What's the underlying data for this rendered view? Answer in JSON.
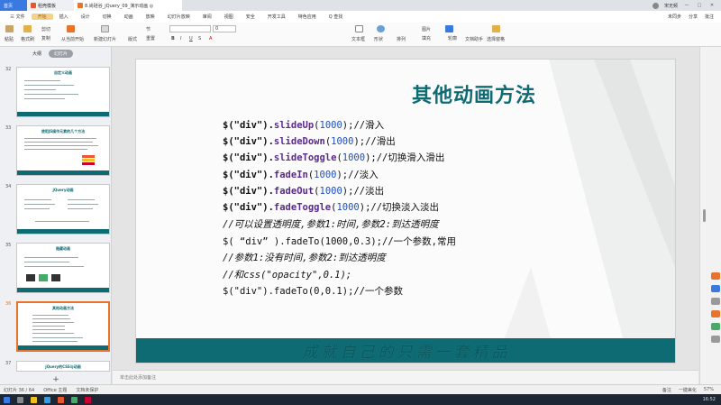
{
  "window": {
    "tabs": [
      {
        "label": "首页"
      },
      {
        "label": "稻壳模板"
      },
      {
        "label": "8.尚硅谷_jQuery_09_演示动画 ◎"
      }
    ],
    "user": "宋无频"
  },
  "menubar": {
    "items": [
      "三 文件",
      "开始",
      "插入",
      "设计",
      "切换",
      "动画",
      "放映",
      "幻灯片放映",
      "审阅",
      "视图",
      "安全",
      "开发工具",
      "特色应用",
      "Q 查找"
    ],
    "active_index": 1,
    "right": [
      "未同步",
      "分享",
      "批注"
    ]
  },
  "ribbon": {
    "paste": "粘贴",
    "format_painter": "格式刷",
    "cut": "剪切",
    "copy": "复制",
    "from_current": "从当前开始",
    "new_slide": "新建幻灯片",
    "layout": "版式",
    "section": "节",
    "reset": "重置",
    "font_size": "0",
    "textbox": "文本框",
    "shape": "形状",
    "arrange": "排列",
    "outline": "轮廓",
    "picture": "图片",
    "fill": "填充",
    "text_effects": "文档助手",
    "select_pane": "选择窗格"
  },
  "leftpanel": {
    "tabs": [
      "大纲",
      "幻灯片"
    ],
    "slides": [
      {
        "num": "32",
        "title": "自定义动画"
      },
      {
        "num": "33",
        "title": "使用JS操作元素的几个方法"
      },
      {
        "num": "34",
        "title": "jQuery动画"
      },
      {
        "num": "35",
        "title": "隐藏动画"
      },
      {
        "num": "36",
        "title": "其他动画方法"
      },
      {
        "num": "37",
        "title": "jQuery的CSS与动画"
      }
    ],
    "selected_index": 4,
    "add_label": "+"
  },
  "slide": {
    "title": "其他动画方法",
    "code_lines": [
      {
        "pre": "$(\"div\").",
        "fn": "slideUp",
        "open": "(",
        "num": "1000",
        "post": ");//滑入"
      },
      {
        "pre": "$(\"div\").",
        "fn": "slideDown",
        "open": "(",
        "num": "1000",
        "post": ");//滑出"
      },
      {
        "pre": "$(\"div\").",
        "fn": "slideToggle",
        "open": "(",
        "num": "1000",
        "post": ");//切换滑入滑出"
      },
      {
        "pre": "$(\"div\").",
        "fn": "fadeIn",
        "open": "(",
        "num": "1000",
        "post": ");//淡入"
      },
      {
        "pre": "$(\"div\").",
        "fn": "fadeOut",
        "open": "(",
        "num": "1000",
        "post": ");//淡出"
      },
      {
        "pre": "$(\"div\").",
        "fn": "fadeToggle",
        "open": "(",
        "num": "1000",
        "post": ");//切换淡入淡出"
      }
    ],
    "notes_lines": [
      "//可以设置透明度,参数1:时间,参数2:到达透明度",
      "$( “div” ).fadeTo(1000,0.3);//一个参数,常用",
      "//参数1:没有时间,参数2:到达透明度",
      "//和css(\"opacity\",0.1);",
      "$(\"div\").fadeTo(0,0.1);//一个参数"
    ],
    "footer": "成就自己的只需一套精品"
  },
  "notes_placeholder": "单击此处添加备注",
  "statusbar": {
    "slide_info": "幻灯片 36 / 64",
    "theme": "Office 主题",
    "lang": "文档未保护",
    "right": [
      "备注",
      "一键美化",
      "57%"
    ]
  },
  "taskbar": {
    "clock": "16:52"
  }
}
